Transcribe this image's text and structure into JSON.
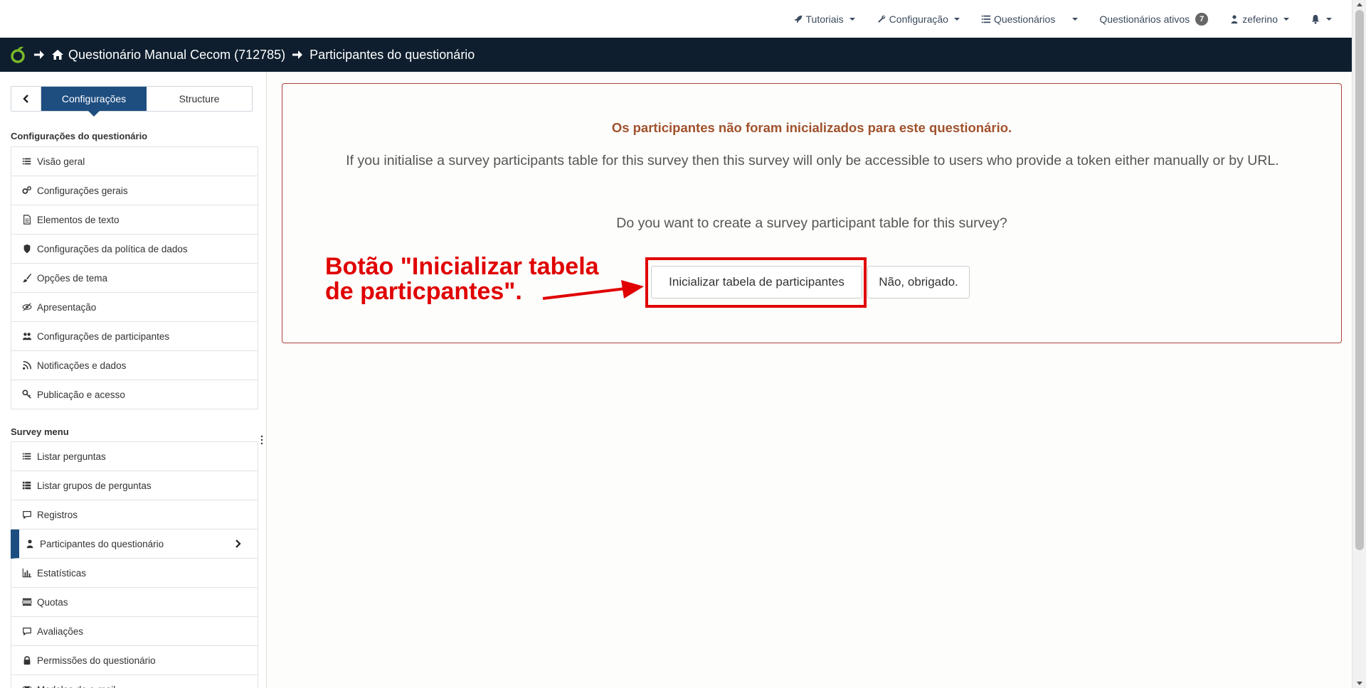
{
  "topnav": {
    "tutorials": "Tutoriais",
    "config": "Configuração",
    "surveys": "Questionários",
    "active_surveys": "Questionários ativos",
    "active_count": "7",
    "user": "zeferino"
  },
  "breadcrumb": {
    "survey": "Questionário Manual Cecom (712785)",
    "page": "Participantes do questionário"
  },
  "sidebar": {
    "tab_settings": "Configurações",
    "tab_structure": "Structure",
    "settings_title": "Configurações do questionário",
    "settings_items": [
      {
        "label": "Visão geral",
        "icon": "list-icon"
      },
      {
        "label": "Configurações gerais",
        "icon": "gears-icon"
      },
      {
        "label": "Elementos de texto",
        "icon": "file-text-icon"
      },
      {
        "label": "Configurações da política de dados",
        "icon": "shield-icon"
      },
      {
        "label": "Opções de tema",
        "icon": "brush-icon"
      },
      {
        "label": "Apresentação",
        "icon": "eye-slash-icon"
      },
      {
        "label": "Configurações de participantes",
        "icon": "users-icon"
      },
      {
        "label": "Notificações e dados",
        "icon": "rss-icon"
      },
      {
        "label": "Publicação e acesso",
        "icon": "key-icon"
      }
    ],
    "menu_title": "Survey menu",
    "menu_items": [
      {
        "label": "Listar perguntas",
        "icon": "list-icon"
      },
      {
        "label": "Listar grupos de perguntas",
        "icon": "th-list-icon"
      },
      {
        "label": "Registros",
        "icon": "comment-icon"
      },
      {
        "label": "Participantes do questionário",
        "icon": "user-icon"
      },
      {
        "label": "Estatísticas",
        "icon": "bar-chart-icon"
      },
      {
        "label": "Quotas",
        "icon": "tasks-icon"
      },
      {
        "label": "Avaliações",
        "icon": "comment-icon"
      },
      {
        "label": "Permissões do questionário",
        "icon": "lock-icon"
      },
      {
        "label": "Modelos de e-mail",
        "icon": "envelope-icon"
      }
    ]
  },
  "main": {
    "warning_title": "Os participantes não foram inicializados para este questionário.",
    "description": "If you initialise a survey participants table for this survey then this survey will only be accessible to users who provide a token either manually or by URL.",
    "question": "Do you want to create a survey participant table for this survey?",
    "init_button": "Inicializar tabela de participantes",
    "no_button": "Não, obrigado."
  },
  "annotation": {
    "line1": "Botão \"Inicializar tabela",
    "line2": "de particpantes\".",
    "color": "#e00000"
  },
  "colors": {
    "navbar_dark": "#0e1e2e",
    "accent": "#1e4e80",
    "warning_text": "#a0522d",
    "panel_border": "#b0413e"
  }
}
